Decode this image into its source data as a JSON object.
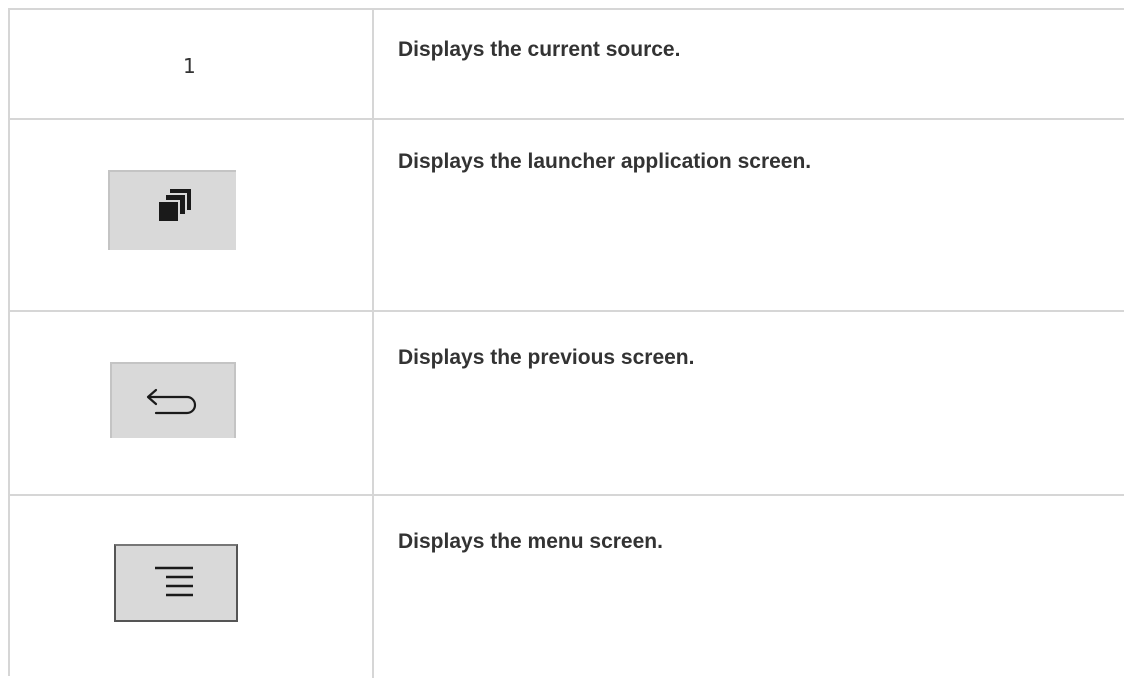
{
  "rows": [
    {
      "icon": "number-label",
      "label": "1",
      "description": "Displays the current source."
    },
    {
      "icon": "launcher-icon",
      "description": "Displays the launcher application screen."
    },
    {
      "icon": "back-icon",
      "description": "Displays the previous screen."
    },
    {
      "icon": "menu-icon",
      "description": "Displays the menu screen."
    }
  ]
}
